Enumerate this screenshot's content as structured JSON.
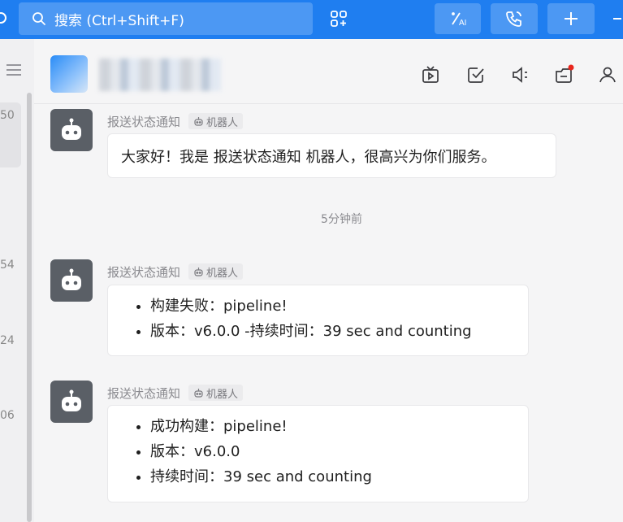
{
  "search": {
    "placeholder": "搜索 (Ctrl+Shift+F)"
  },
  "sidebar": {
    "numbers": [
      "50",
      "54",
      "24",
      "06"
    ]
  },
  "chat": {
    "timestamp": "5分钟前",
    "messages": [
      {
        "sender": "报送状态通知",
        "tag": "机器人",
        "text": "大家好！我是 报送状态通知 机器人，很高兴为你们服务。"
      },
      {
        "sender": "报送状态通知",
        "tag": "机器人",
        "items": [
          "构建失败：pipeline!",
          "版本：v6.0.0 -持续时间：39 sec and counting"
        ]
      },
      {
        "sender": "报送状态通知",
        "tag": "机器人",
        "items": [
          "成功构建：pipeline!",
          "版本：v6.0.0",
          "持续时间：39 sec and counting"
        ]
      }
    ]
  },
  "icons": {
    "search": "search-icon",
    "apps": "apps-grid-icon",
    "ai": "ai-icon",
    "call": "phone-call-icon",
    "add": "plus-icon",
    "menu": "menu-icon",
    "tv": "tv-icon",
    "task": "task-check-icon",
    "announce": "announcement-icon",
    "notes": "notes-icon",
    "member": "member-icon",
    "bot": "robot-icon"
  },
  "colors": {
    "topbar": "#1f7ef0",
    "badge": "#e8261d"
  }
}
